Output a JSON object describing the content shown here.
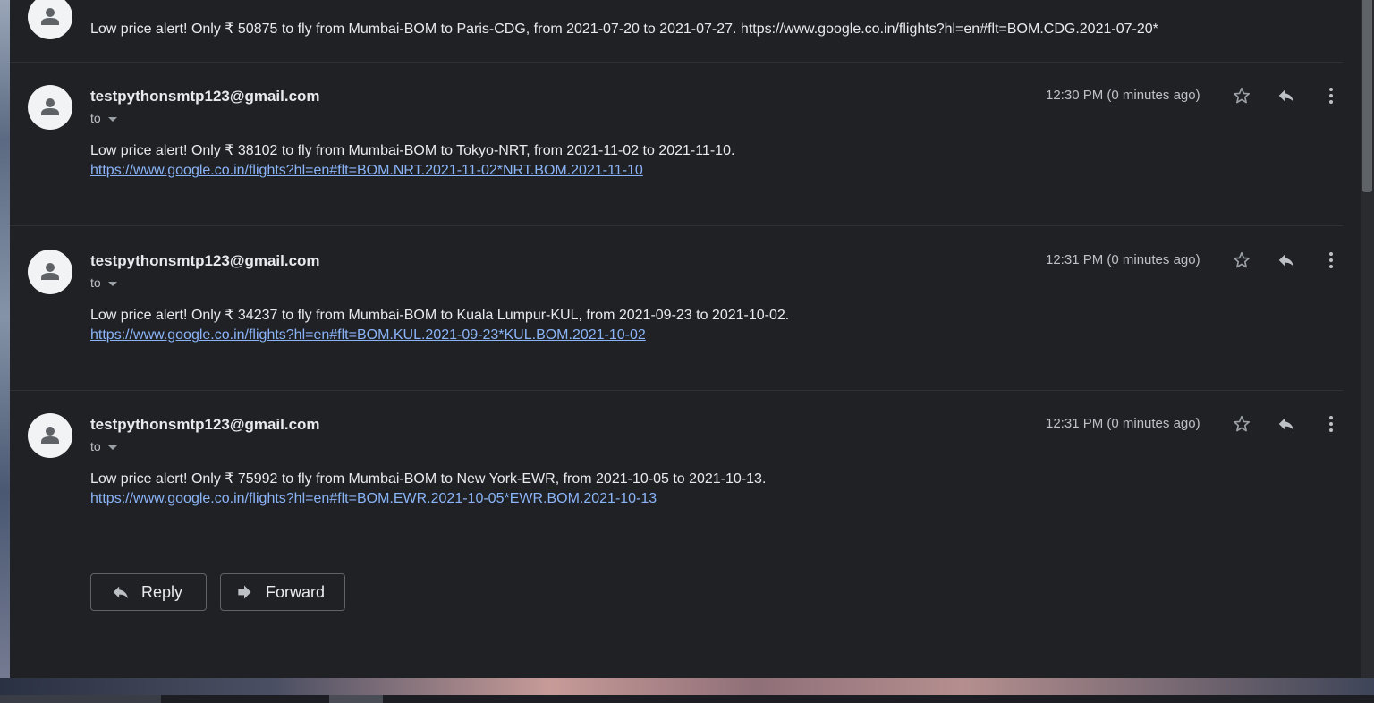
{
  "top_partial_email": {
    "body": "Low price alert! Only ₹ 50875 to fly from Mumbai-BOM to Paris-CDG, from 2021-07-20 to 2021-07-27. https://www.google.co.in/flights?hl=en#flt=BOM.CDG.2021-07-20*"
  },
  "emails": [
    {
      "sender": "testpythonsmtp123@gmail.com",
      "to_label": "to",
      "time": "12:30 PM (0 minutes ago)",
      "body": "Low price alert! Only ₹ 38102 to fly from Mumbai-BOM to Tokyo-NRT, from 2021-11-02 to 2021-11-10.",
      "link": "https://www.google.co.in/flights?hl=en#flt=BOM.NRT.2021-11-02*NRT.BOM.2021-11-10"
    },
    {
      "sender": "testpythonsmtp123@gmail.com",
      "to_label": "to",
      "time": "12:31 PM (0 minutes ago)",
      "body": "Low price alert! Only ₹ 34237 to fly from Mumbai-BOM to Kuala Lumpur-KUL, from 2021-09-23 to 2021-10-02.",
      "link": "https://www.google.co.in/flights?hl=en#flt=BOM.KUL.2021-09-23*KUL.BOM.2021-10-02"
    },
    {
      "sender": "testpythonsmtp123@gmail.com",
      "to_label": "to",
      "time": "12:31 PM (0 minutes ago)",
      "body": "Low price alert! Only ₹ 75992 to fly from Mumbai-BOM to New York-EWR, from 2021-10-05 to 2021-10-13.",
      "link": "https://www.google.co.in/flights?hl=en#flt=BOM.EWR.2021-10-05*EWR.BOM.2021-10-13"
    }
  ],
  "actions": {
    "reply_label": "Reply",
    "forward_label": "Forward"
  },
  "icons": {
    "avatar": "person-icon",
    "star": "star-icon",
    "reply": "reply-icon",
    "more": "more-vert-icon",
    "forward": "forward-icon"
  },
  "colors": {
    "panel_bg": "#202124",
    "text": "#e8eaed",
    "link": "#8ab4f8",
    "muted": "#bdc1c6"
  }
}
